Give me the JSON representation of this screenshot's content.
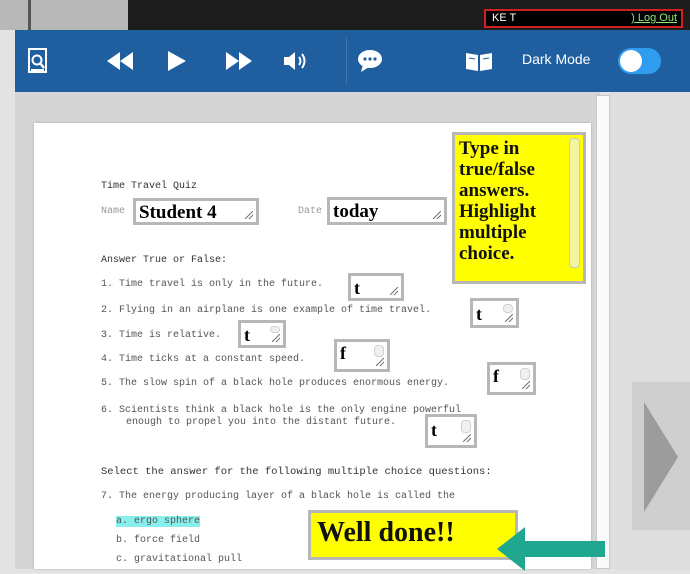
{
  "user": {
    "name": "KE T",
    "logout_label": ") Log Out"
  },
  "toolbar": {
    "dark_mode_label": "Dark Mode",
    "dark_mode_on": true
  },
  "quiz": {
    "title": "Time Travel Quiz",
    "name_label": "Name",
    "name_value": "Student 4",
    "date_label": "Date",
    "date_value": "today",
    "instruction_note": [
      "Type in",
      "true/false",
      "answers.",
      "Highlight",
      "multiple",
      "choice."
    ],
    "tf_heading": "Answer True or False:",
    "tf_questions": [
      {
        "text": "1. Time travel is only in the future.",
        "answer": "t"
      },
      {
        "text": "2. Flying in an airplane is one example of time travel.",
        "answer": "t"
      },
      {
        "text": "3. Time is relative.",
        "answer": "t"
      },
      {
        "text": "4. Time ticks at a constant speed.",
        "answer": "f"
      },
      {
        "text": "5. The slow spin of a black hole produces enormous energy.",
        "answer": "f"
      },
      {
        "text_line1": "6.  Scientists think a black hole is the only engine powerful",
        "text_line2": "enough to propel you into the distant future.",
        "answer": "t"
      }
    ],
    "mc_heading": "Select the answer for the following multiple choice questions:",
    "mc_question": "7. The energy producing layer of a black hole is called the",
    "mc_options": [
      "a. ergo sphere",
      "b. force field",
      "c. gravitational pull"
    ],
    "mc_selected_index": 0,
    "feedback": "Well done!!"
  },
  "colors": {
    "toolbar": "#1f5fa0",
    "note": "#ffff00",
    "highlight": "#87f0ec",
    "arrow": "#1fa88f"
  }
}
